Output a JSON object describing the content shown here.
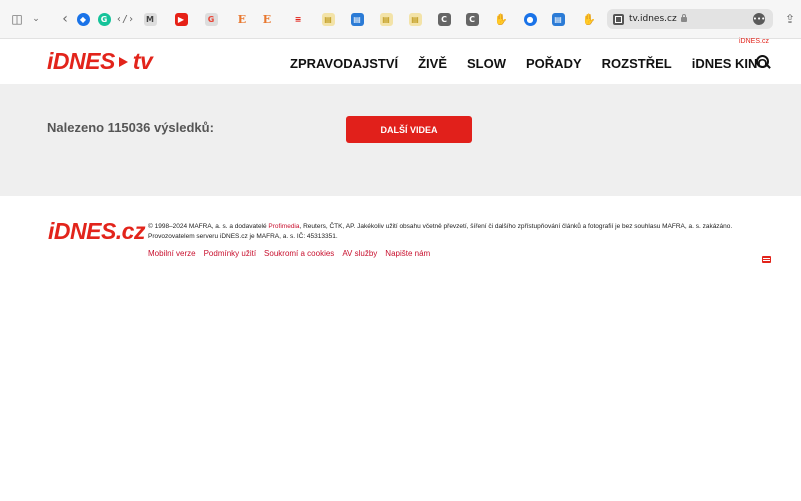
{
  "browser": {
    "address": "tv.idnes.cz",
    "tab_favicons": [
      "M",
      "▶",
      "G",
      "E",
      "E",
      "≡",
      "▤",
      "▤",
      "▤",
      "▤",
      "C",
      "C",
      "●",
      "▤"
    ]
  },
  "header": {
    "small_link": "iDNES.cz",
    "logo_left": "iDNES",
    "logo_right": "tv",
    "nav": [
      "ZPRAVODAJSTVÍ",
      "ŽIVĚ",
      "SLOW",
      "POŘADY",
      "ROZSTŘEL",
      "iDNES KINO"
    ]
  },
  "results": {
    "title": "Nalezeno 115036 výsledků:",
    "more_button": "DALŠÍ VIDEA"
  },
  "footer": {
    "logo": "iDNES.cz",
    "copyright_1": "© 1998–2024 MAFRA, a. s. a dodavatelé ",
    "copyright_link": "Profimedia",
    "copyright_2": ", Reuters, ČTK, AP. Jakékoliv užití obsahu včetně převzetí, šíření či dalšího zpřístupňování článků a fotografií je bez souhlasu MAFRA, a. s. zakázáno. Provozovatelem serveru iDNES.cz je MAFRA, a. s. IČ: 45313351.",
    "links": [
      "Mobilní verze",
      "Podmínky užití",
      "Soukromí a cookies",
      "AV služby",
      "Napište nám"
    ]
  },
  "colors": {
    "brand_red": "#e2241b",
    "panel_gray": "#efefef"
  }
}
